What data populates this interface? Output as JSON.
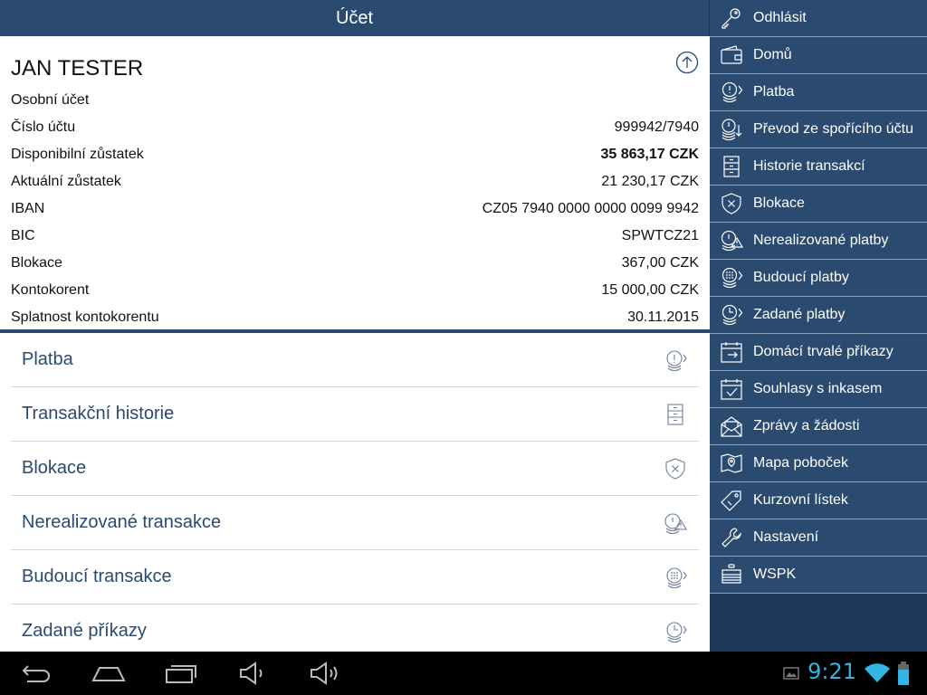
{
  "header": {
    "title": "Účet"
  },
  "account": {
    "name": "JAN TESTER",
    "type": "Osobní účet",
    "rows": [
      {
        "label": "Číslo účtu",
        "value": "999942/7940",
        "bold": false
      },
      {
        "label": "Disponibilní zůstatek",
        "value": "35 863,17 CZK",
        "bold": true
      },
      {
        "label": "Aktuální zůstatek",
        "value": "21 230,17 CZK",
        "bold": false
      },
      {
        "label": "IBAN",
        "value": "CZ05 7940 0000 0000 0099 9942",
        "bold": false
      },
      {
        "label": "BIC",
        "value": "SPWTCZ21",
        "bold": false
      },
      {
        "label": "Blokace",
        "value": "367,00 CZK",
        "bold": false
      },
      {
        "label": "Kontokorent",
        "value": "15 000,00 CZK",
        "bold": false
      },
      {
        "label": "Splatnost kontokorentu",
        "value": "30.11.2015",
        "bold": false
      }
    ]
  },
  "actions": [
    {
      "label": "Platba",
      "icon": "coin-arrow-icon"
    },
    {
      "label": "Transakční historie",
      "icon": "cabinet-icon"
    },
    {
      "label": "Blokace",
      "icon": "shield-x-icon"
    },
    {
      "label": "Nerealizované transakce",
      "icon": "coin-warning-icon"
    },
    {
      "label": "Budoucí transakce",
      "icon": "coin-keypad-icon"
    },
    {
      "label": "Zadané příkazy",
      "icon": "coin-clock-icon"
    }
  ],
  "sidebar": {
    "items": [
      {
        "label": "Odhlásit",
        "icon": "key-icon"
      },
      {
        "label": "Domů",
        "icon": "wallet-icon"
      },
      {
        "label": "Platba",
        "icon": "coin-arrow-icon"
      },
      {
        "label": "Převod ze spořícího účtu",
        "icon": "coins-down-icon"
      },
      {
        "label": "Historie transakcí",
        "icon": "cabinet-icon"
      },
      {
        "label": "Blokace",
        "icon": "shield-x-icon"
      },
      {
        "label": "Nerealizované platby",
        "icon": "coin-warning-icon"
      },
      {
        "label": "Budoucí platby",
        "icon": "coin-keypad-icon"
      },
      {
        "label": "Zadané platby",
        "icon": "coin-clock-icon"
      },
      {
        "label": "Domácí trvalé příkazy",
        "icon": "calendar-arrow-icon"
      },
      {
        "label": "Souhlasy s inkasem",
        "icon": "calendar-check-icon"
      },
      {
        "label": "Zprávy a žádosti",
        "icon": "envelope-icon"
      },
      {
        "label": "Mapa poboček",
        "icon": "map-icon"
      },
      {
        "label": "Kurzovní lístek",
        "icon": "tag-icon"
      },
      {
        "label": "Nastavení",
        "icon": "wrench-icon"
      },
      {
        "label": "WSPK",
        "icon": "piggy-icon"
      }
    ]
  },
  "statusbar": {
    "time": "9:21"
  },
  "colors": {
    "accent": "#2a4a70",
    "sidebar": "#2a4a70",
    "clock": "#33b5e5",
    "rowline": "#bfe0e8"
  }
}
